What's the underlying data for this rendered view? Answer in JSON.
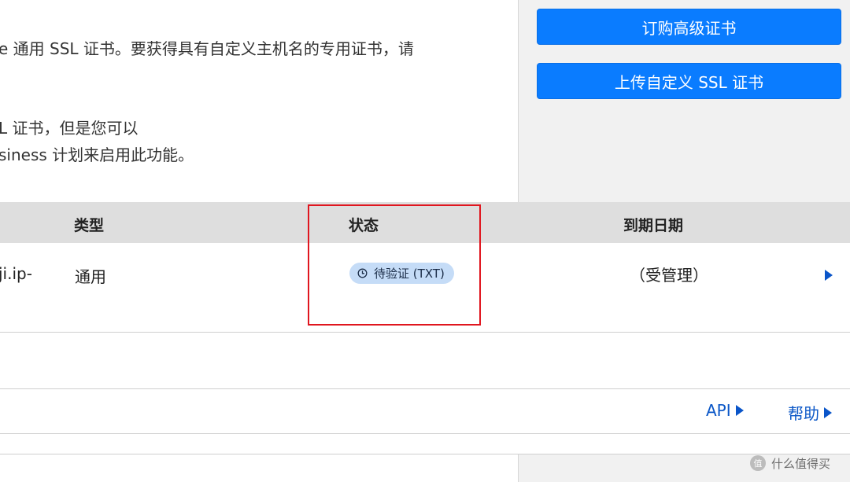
{
  "description": {
    "line1": "e 通用 SSL 证书。要获得具有自定义主机名的专用证书，请",
    "line2": "L 证书，但是您可以",
    "line3": "siness 计划来启用此功能。"
  },
  "actions": {
    "order_advanced_cert": "订购高级证书",
    "upload_custom_ssl": "上传自定义 SSL 证书"
  },
  "table": {
    "headers": {
      "type": "类型",
      "status": "状态",
      "expiry": "到期日期"
    },
    "rows": [
      {
        "host": "ji.ip-",
        "type": "通用",
        "status": "待验证 (TXT)",
        "expiry": "（受管理）"
      }
    ]
  },
  "footer": {
    "api_link": "API",
    "help_link": "帮助"
  },
  "watermark": {
    "text": "什么值得买"
  },
  "colors": {
    "primary": "#0a7cff",
    "link": "#0b57c7",
    "highlight": "#e0161f",
    "badge_bg": "#c5dcf7"
  },
  "icons": {
    "status": "clock-icon",
    "row_expand": "caret-right-icon",
    "watermark": "smzdm-logo"
  }
}
